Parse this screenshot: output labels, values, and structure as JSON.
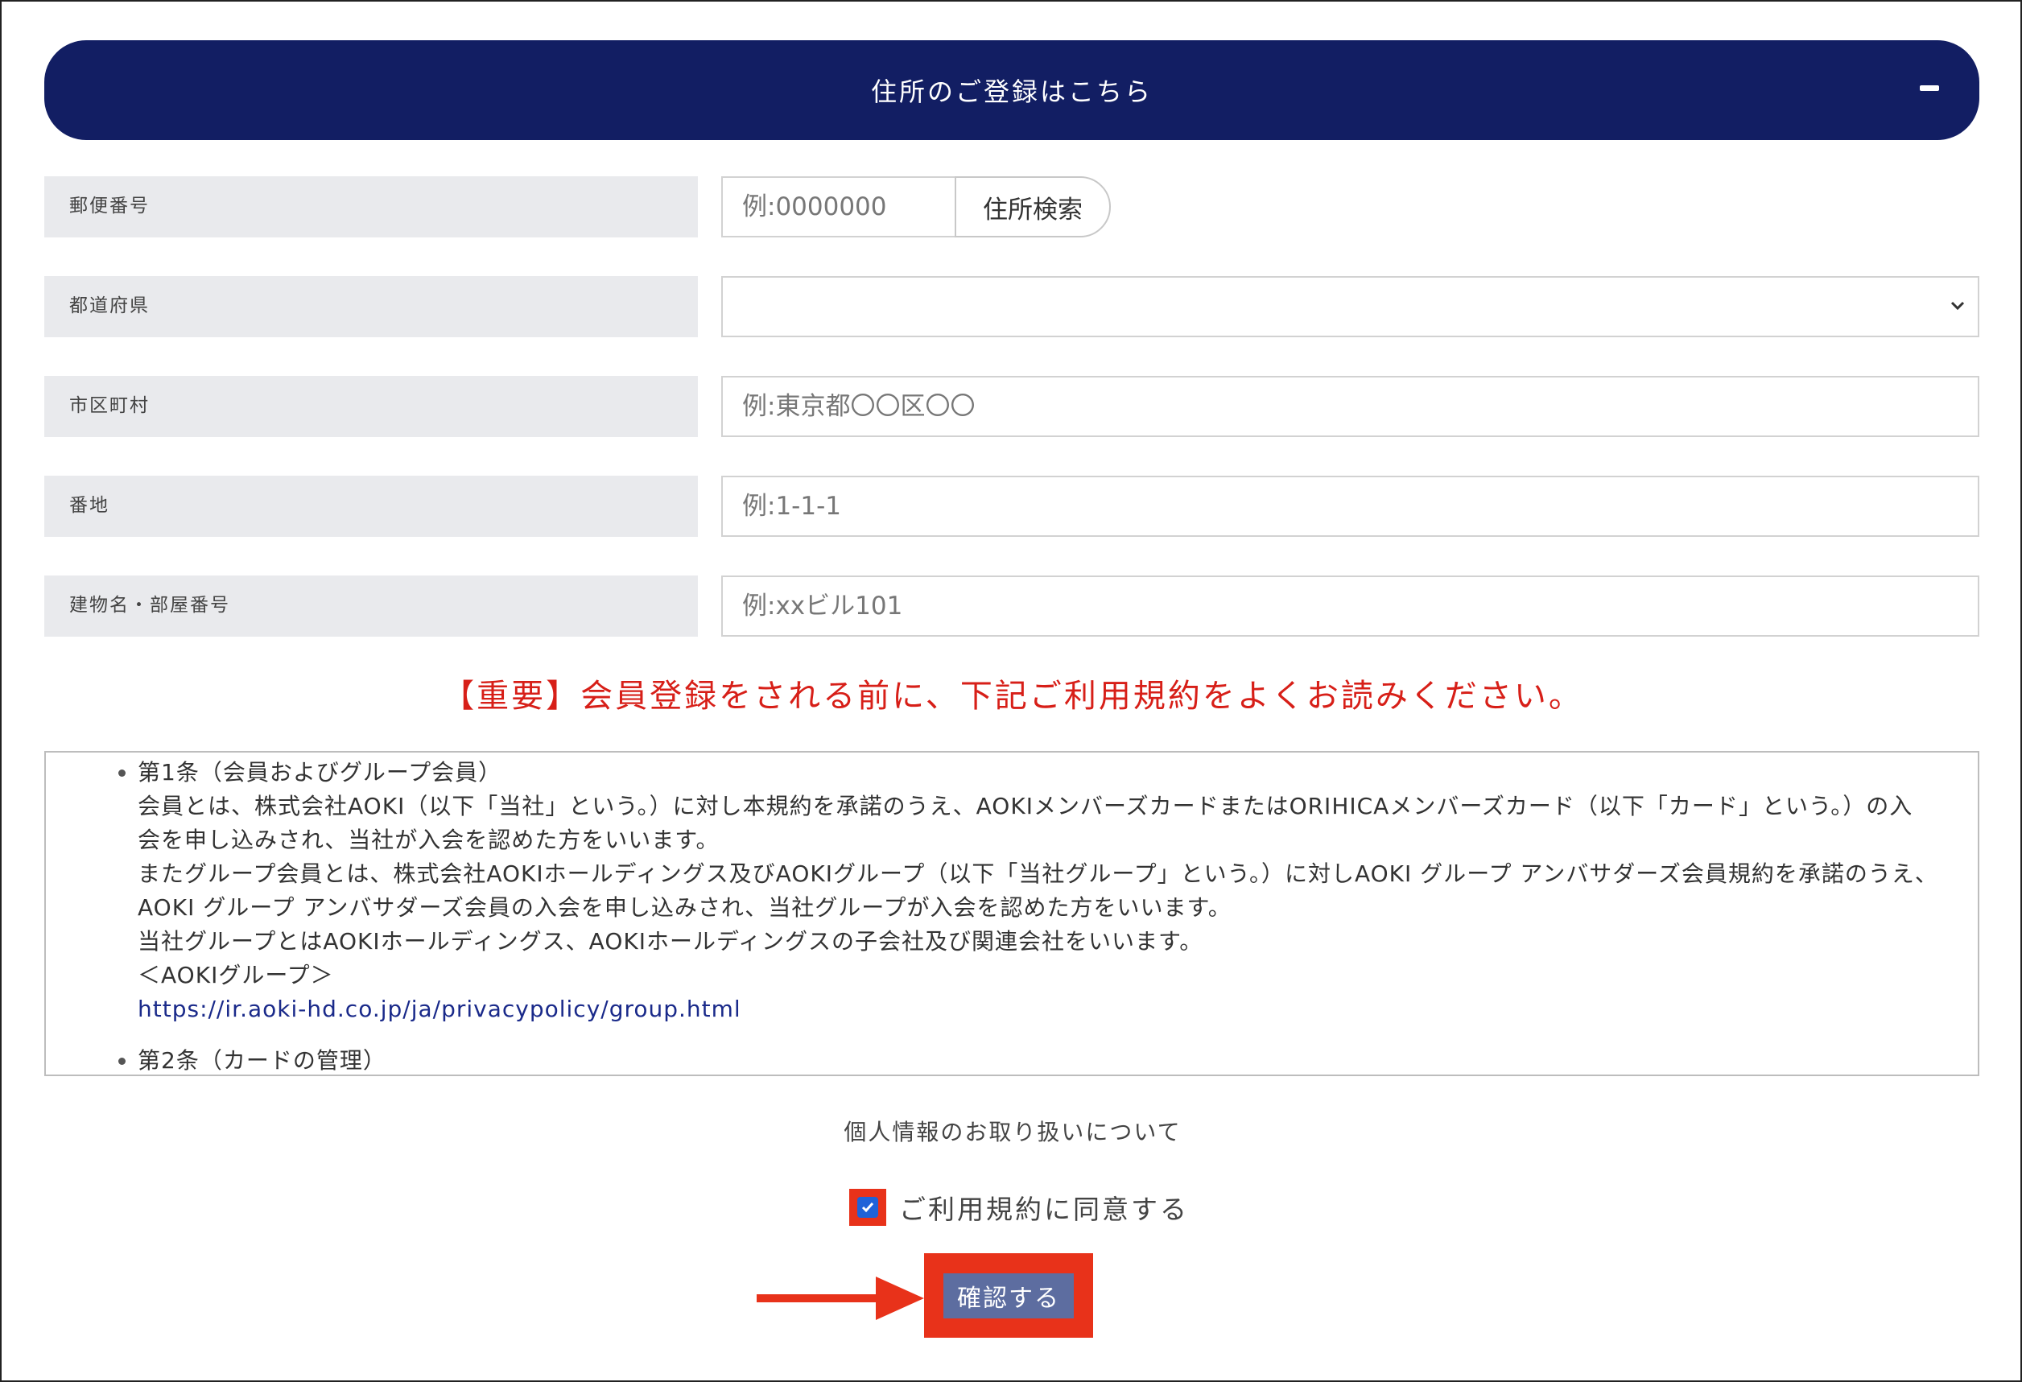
{
  "header": {
    "title": "住所のご登録はこちら",
    "toggle_icon": "minus-icon"
  },
  "form": {
    "postal_code": {
      "label": "郵便番号",
      "placeholder": "例:0000000",
      "search_button": "住所検索"
    },
    "prefecture": {
      "label": "都道府県",
      "selected": ""
    },
    "city": {
      "label": "市区町村",
      "placeholder": "例:東京都〇〇区〇〇"
    },
    "street": {
      "label": "番地",
      "placeholder": "例:1-1-1"
    },
    "building": {
      "label": "建物名・部屋番号",
      "placeholder": "例:xxビル101"
    }
  },
  "notice": "【重要】会員登録をされる前に、下記ご利用規約をよくお読みください。",
  "terms": {
    "article1_title": "第1条（会員およびグループ会員）",
    "article1_lines": [
      "会員とは、株式会社AOKI（以下「当社」という。）に対し本規約を承諾のうえ、AOKIメンバーズカードまたはORIHICAメンバーズカード（以下「カード」という。）の入",
      "会を申し込みされ、当社が入会を認めた方をいいます。",
      "またグループ会員とは、株式会社AOKIホールディングス及びAOKIグループ（以下「当社グループ」という。）に対しAOKI グループ アンバサダーズ会員規約を承諾のうえ、",
      "AOKI グループ アンバサダーズ会員の入会を申し込みされ、当社グループが入会を認めた方をいいます。",
      "当社グループとはAOKIホールディングス、AOKIホールディングスの子会社及び関連会社をいいます。",
      "＜AOKIグループ＞"
    ],
    "article1_link": "https://ir.aoki-hd.co.jp/ja/privacypolicy/group.html",
    "article2_title": "第2条（カードの管理）"
  },
  "privacy_link": "個人情報のお取り扱いについて",
  "agreement": {
    "label": "ご利用規約に同意する",
    "checked": true
  },
  "confirm_button": "確認する",
  "colors": {
    "header_bg": "#121e63",
    "notice_red": "#d71f18",
    "highlight_red": "#e8321a",
    "confirm_bg": "#5d6da0",
    "label_bg": "#e9eaed",
    "link_blue": "#1a2a8a"
  }
}
